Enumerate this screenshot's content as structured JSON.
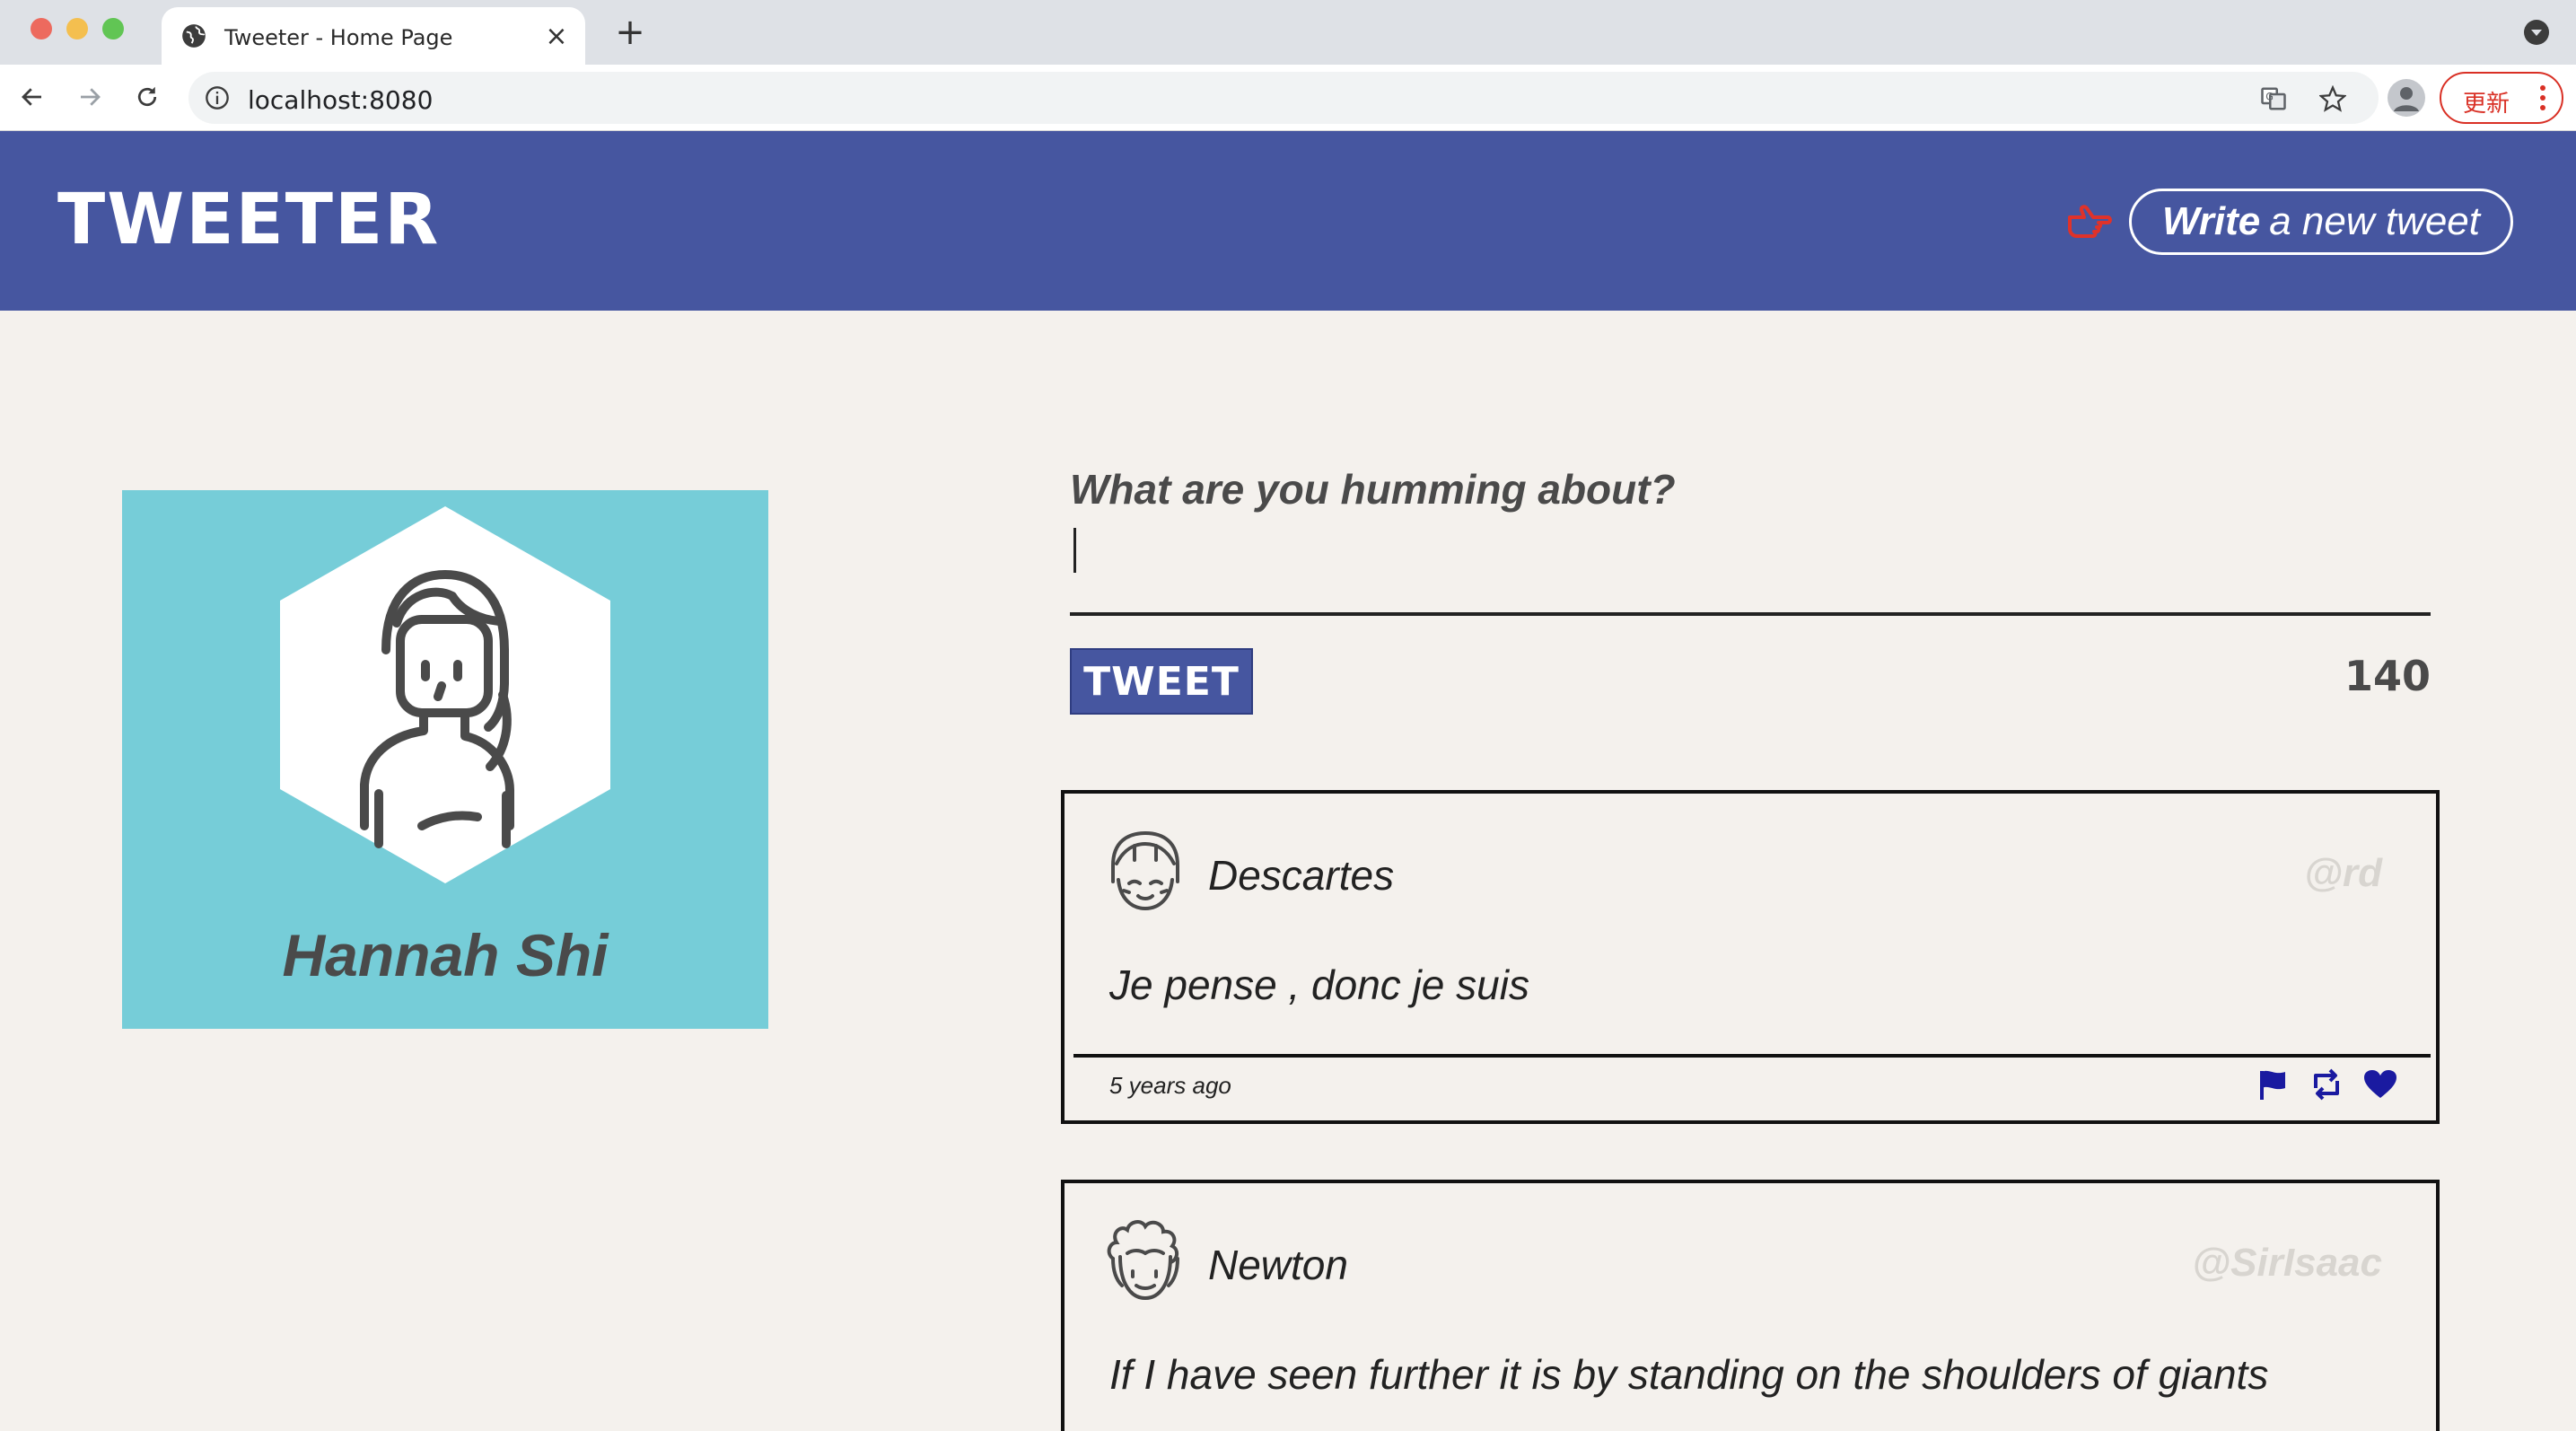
{
  "browser": {
    "tab_title": "Tweeter - Home Page",
    "close_glyph": "×",
    "new_tab_glyph": "+",
    "url": "localhost:8080",
    "update_label": "更新"
  },
  "header": {
    "brand": "TWEETER",
    "compose_bold": "Write",
    "compose_rest": "a new tweet"
  },
  "profile": {
    "name": "Hannah Shi"
  },
  "composer": {
    "label": "What are you humming about?",
    "value": "",
    "tweet_button": "TWEET",
    "counter": "140"
  },
  "tweets": [
    {
      "author": "Descartes",
      "handle": "@rd",
      "content": "Je pense , donc je suis",
      "timestamp": "5 years ago"
    },
    {
      "author": "Newton",
      "handle": "@SirIsaac",
      "content": "If I have seen further it is by standing on the shoulders of giants"
    }
  ],
  "colors": {
    "header_bg": "#4656a0",
    "page_bg": "#f4f1ed",
    "profile_bg": "#76cdd8",
    "accent_red": "#e0322a",
    "action_icon": "#1a1aa0"
  },
  "icons": {
    "tab_favicon": "globe-icon",
    "back": "back-arrow-icon",
    "forward": "forward-arrow-icon",
    "reload": "reload-icon",
    "site_info": "info-icon",
    "translate": "translate-icon",
    "bookmark": "star-icon",
    "profile": "person-icon",
    "compose_hint": "pointing-hand-icon",
    "flag": "flag-icon",
    "retweet": "retweet-icon",
    "like": "heart-icon"
  }
}
